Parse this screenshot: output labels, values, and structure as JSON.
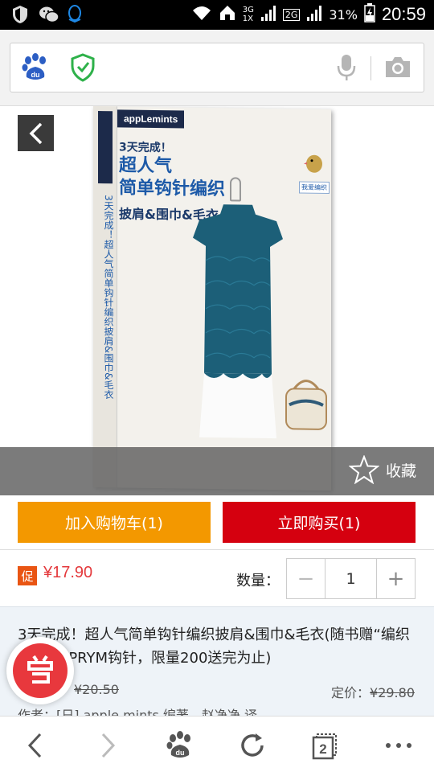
{
  "status_bar": {
    "network_top": "3G",
    "network_bottom": "1X",
    "network2": "2G",
    "battery": "31%",
    "time": "20:59"
  },
  "address_bar": {
    "icons": [
      "baidu-paw-icon",
      "shield-check-icon",
      "microphone-icon",
      "camera-icon"
    ]
  },
  "hero": {
    "book_cover": {
      "publisher_logo": "appLemints",
      "subtitle": "3天完成！",
      "title_line1": "超人气",
      "title_line2": "简单钩针编织",
      "title_line3": "披肩&围巾&毛衣",
      "tag": "我爱编织",
      "spine_text": "3天完成！超人气简单钩针编织披肩&围巾&毛衣"
    },
    "collect_label": "收藏"
  },
  "actions": {
    "add_to_cart": "加入购物车(1)",
    "buy_now": "立即购买(1)"
  },
  "price": {
    "promo_badge": "促",
    "current": "¥17.90",
    "quantity_label": "数量：",
    "minus": "−",
    "quantity": "1",
    "plus": "+"
  },
  "product": {
    "title": "3天完成！超人气简单钩针编织披肩&围巾&毛衣(随书赠“编织堂”德国PRYM钩针，限量200送完为止)",
    "sale_price": "¥20.50",
    "list_label": "定价：",
    "list_price": "¥29.80",
    "author": "作者：[日] apple mints 编著，赵净净 译"
  },
  "colors": {
    "cart": "#f39800",
    "buy": "#d5000f",
    "price": "#e4393c",
    "promo": "#e95513"
  }
}
